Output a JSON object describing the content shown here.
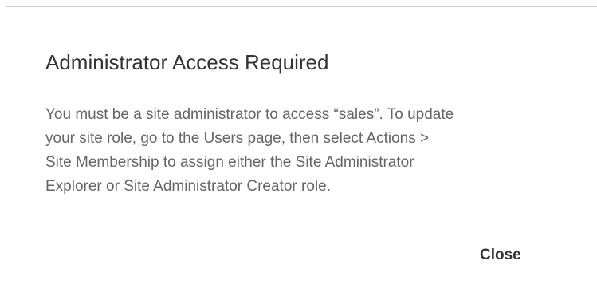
{
  "dialog": {
    "title": "Administrator Access Required",
    "message": "You must be a site administrator to access “sales”. To update\nyour site role, go to the Users page, then select Actions >\nSite Membership to assign either the Site Administrator\nExplorer or Site Administrator Creator role.",
    "close_label": "Close"
  }
}
